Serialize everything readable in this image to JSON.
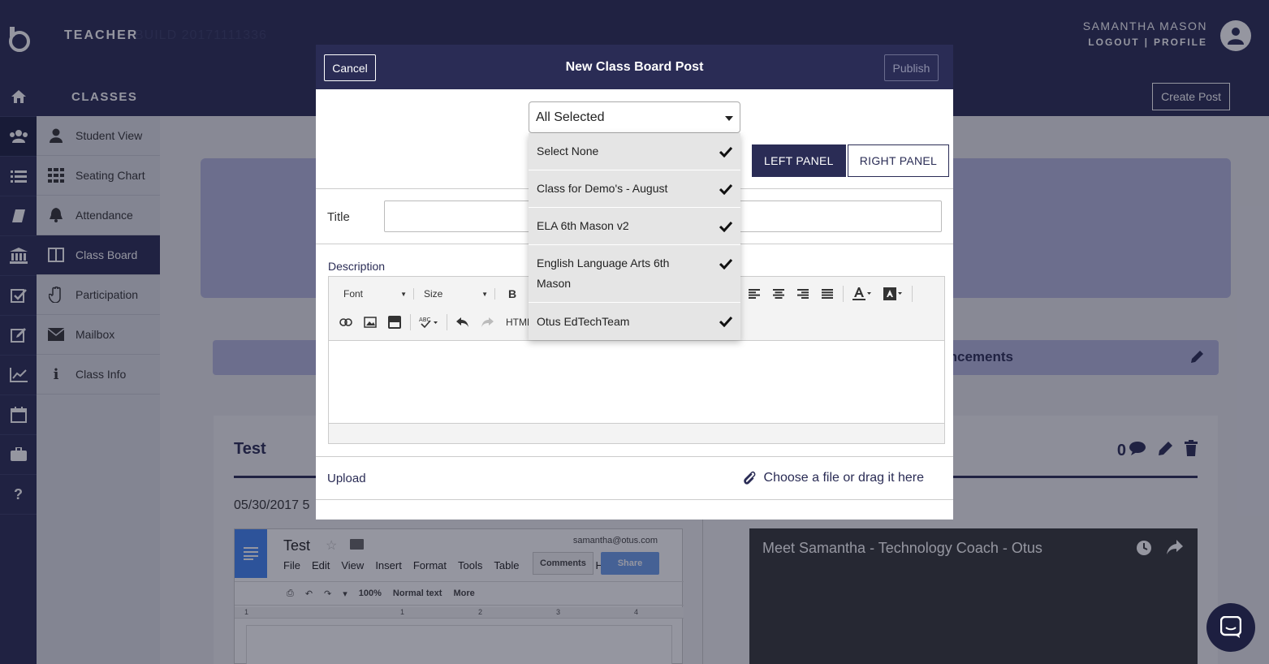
{
  "app": {
    "title": "TEACHER",
    "build": "BUILD 20171111336",
    "user_name": "SAMANTHA MASON",
    "logout": "LOGOUT",
    "profile": "PROFILE",
    "separator": "|"
  },
  "subbar": {
    "section_title": "CLASSES",
    "create_post": "Create Post"
  },
  "sidenav": {
    "items": [
      {
        "label": "Student View",
        "icon": "user-icon"
      },
      {
        "label": "Seating Chart",
        "icon": "grid-icon"
      },
      {
        "label": "Attendance",
        "icon": "bell-icon"
      },
      {
        "label": "Class Board",
        "icon": "columns-icon"
      },
      {
        "label": "Participation",
        "icon": "hand-icon"
      },
      {
        "label": "Mailbox",
        "icon": "envelope-icon"
      },
      {
        "label": "Class Info",
        "icon": "info-icon"
      }
    ],
    "active_index": 3
  },
  "background": {
    "announcements": "ncements",
    "post_title": "Test",
    "post_date": "05/30/2017 5",
    "comment_count": "0",
    "gdoc": {
      "title": "Test",
      "email": "samantha@otus.com",
      "menu": [
        "File",
        "Edit",
        "View",
        "Insert",
        "Format",
        "Tools",
        "Table",
        "Help"
      ],
      "comments": "Comments",
      "share": "Share",
      "zoom": "100%",
      "style": "Normal text",
      "more": "More",
      "ruler": [
        "1",
        "1",
        "2",
        "3",
        "4"
      ]
    },
    "video_title": "Meet Samantha - Technology Coach - Otus"
  },
  "modal": {
    "title": "New Class Board Post",
    "cancel": "Cancel",
    "publish": "Publish",
    "select_value": "All Selected",
    "left_panel": "LEFT PANEL",
    "right_panel": "RIGHT PANEL",
    "title_label": "Title",
    "title_value": "",
    "description_label": "Description",
    "toolbar": {
      "font": "Font",
      "size": "Size",
      "bold": "B",
      "html": "HTML"
    },
    "upload_label": "Upload",
    "upload_drop": "Choose a file or drag it here"
  },
  "dropdown": {
    "options": [
      {
        "label": "Select None",
        "checked": true
      },
      {
        "label": "Class for Demo's - August",
        "checked": true
      },
      {
        "label": "ELA 6th Mason v2",
        "checked": true
      },
      {
        "label": "English Language Arts 6th Mason",
        "checked": true
      },
      {
        "label": "Otus EdTechTeam",
        "checked": true
      }
    ]
  },
  "colors": {
    "brand_navy": "#2a2c55",
    "banner_lavender": "#b4b6dc",
    "dropdown_bg": "#e5e5e5"
  }
}
